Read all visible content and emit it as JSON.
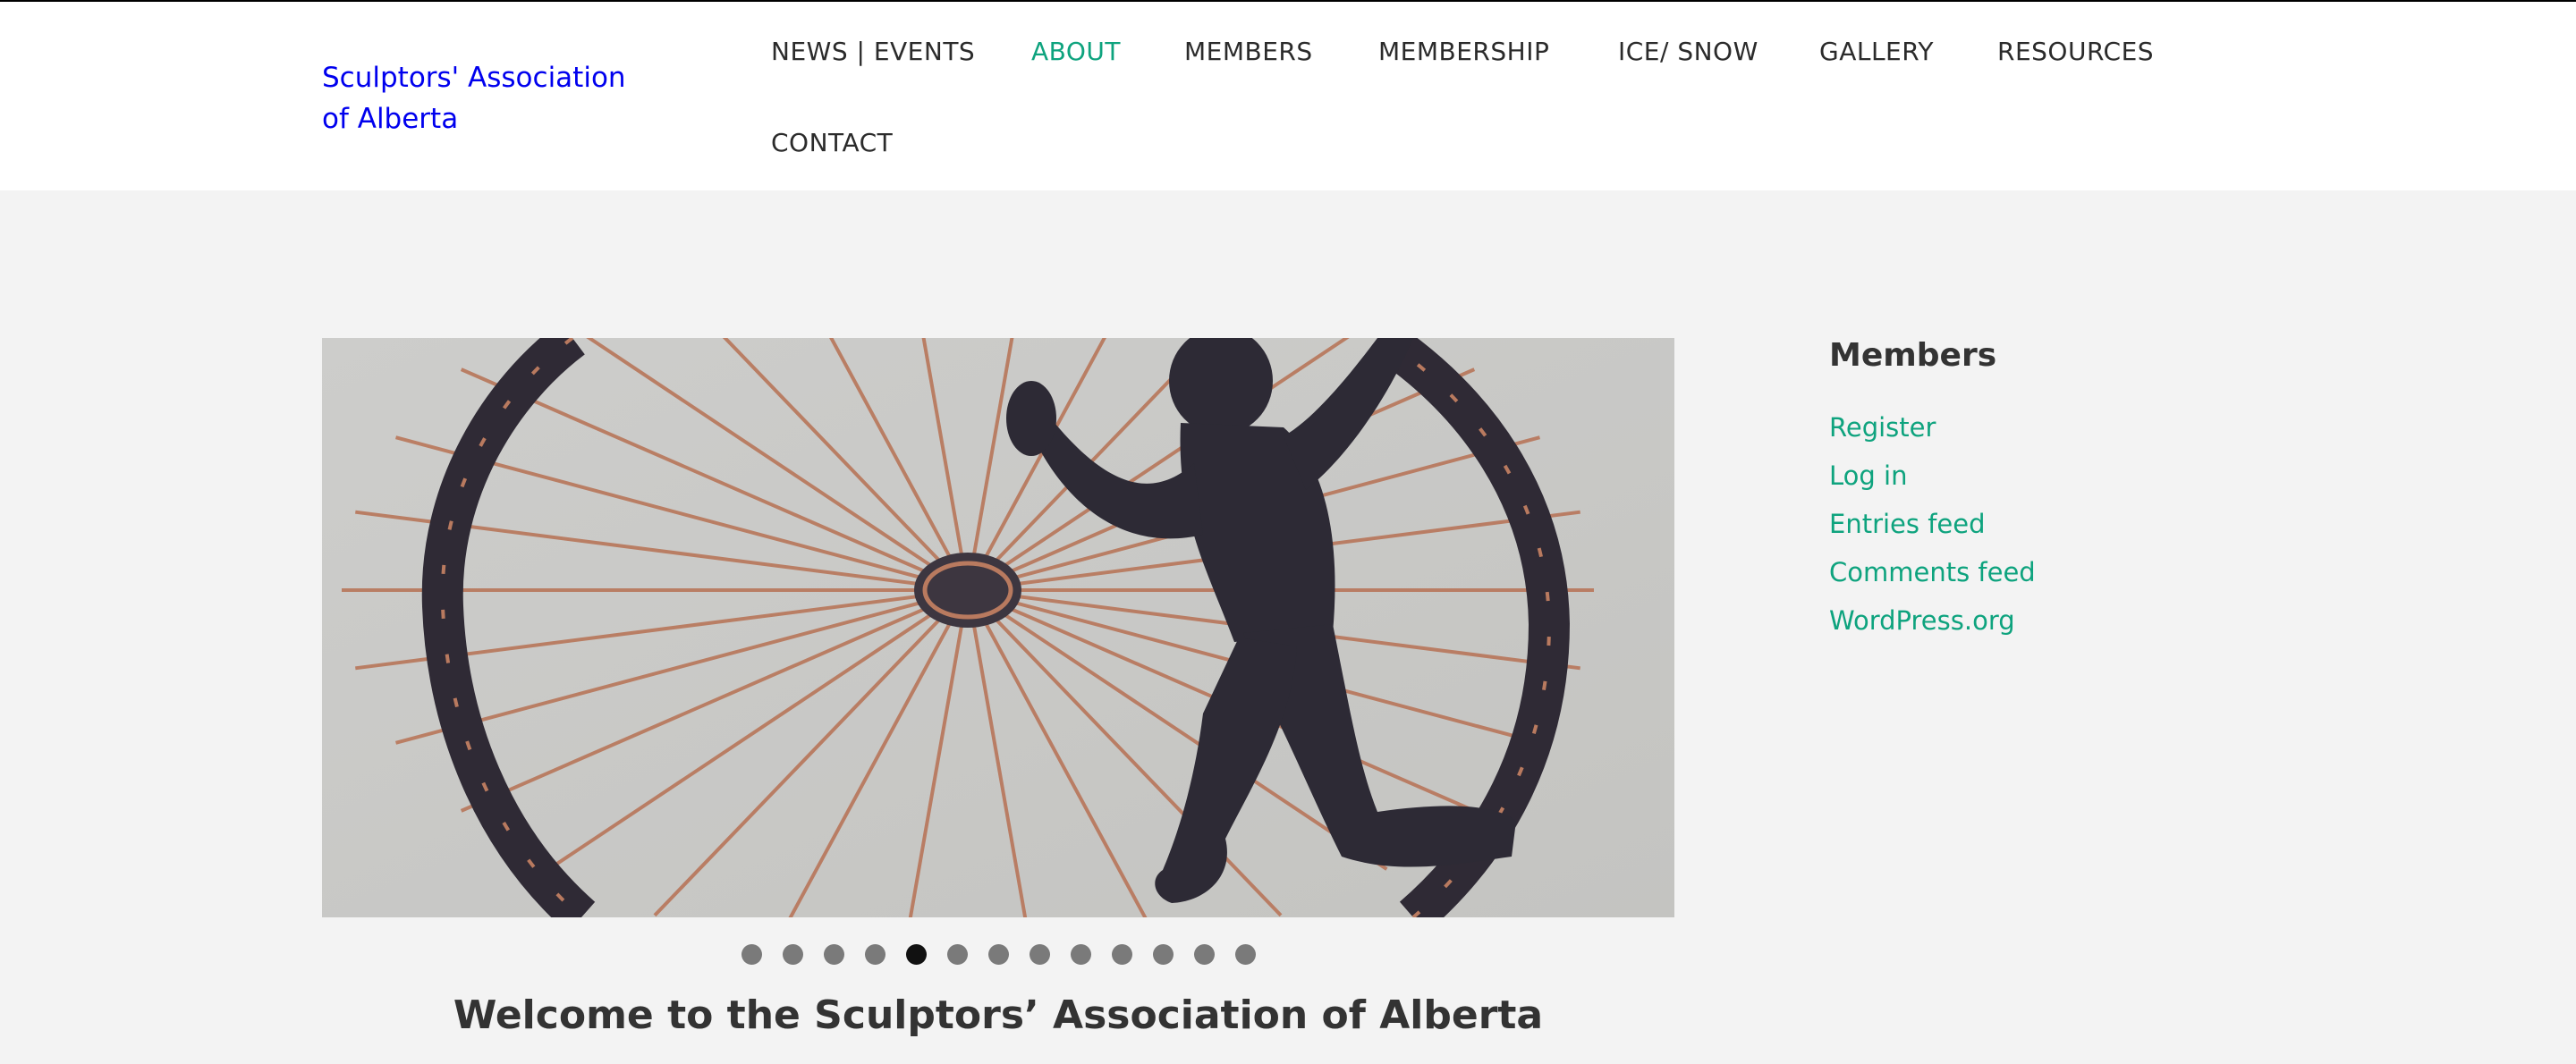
{
  "site": {
    "title": "Sculptors' Association of Alberta"
  },
  "nav": {
    "items": [
      {
        "label": "NEWS | EVENTS",
        "active": false
      },
      {
        "label": "ABOUT",
        "active": true
      },
      {
        "label": "MEMBERS",
        "active": false
      },
      {
        "label": "MEMBERSHIP",
        "active": false
      },
      {
        "label": "ICE/ SNOW",
        "active": false
      },
      {
        "label": "GALLERY",
        "active": false
      },
      {
        "label": "RESOURCES",
        "active": false
      },
      {
        "label": "CONTACT",
        "active": false
      }
    ]
  },
  "slider": {
    "slide_count": 13,
    "active_index": 4
  },
  "main": {
    "welcome_heading": "Welcome to the Sculptors’ Association of Alberta"
  },
  "sidebar": {
    "widget_title": "Members",
    "links": [
      {
        "label": "Register"
      },
      {
        "label": "Log in"
      },
      {
        "label": "Entries feed"
      },
      {
        "label": "Comments feed"
      },
      {
        "label": "WordPress.org"
      }
    ]
  },
  "colors": {
    "accent": "#0ea37e",
    "title_link": "#0000ee",
    "text": "#333333",
    "background": "#f3f3f3"
  }
}
